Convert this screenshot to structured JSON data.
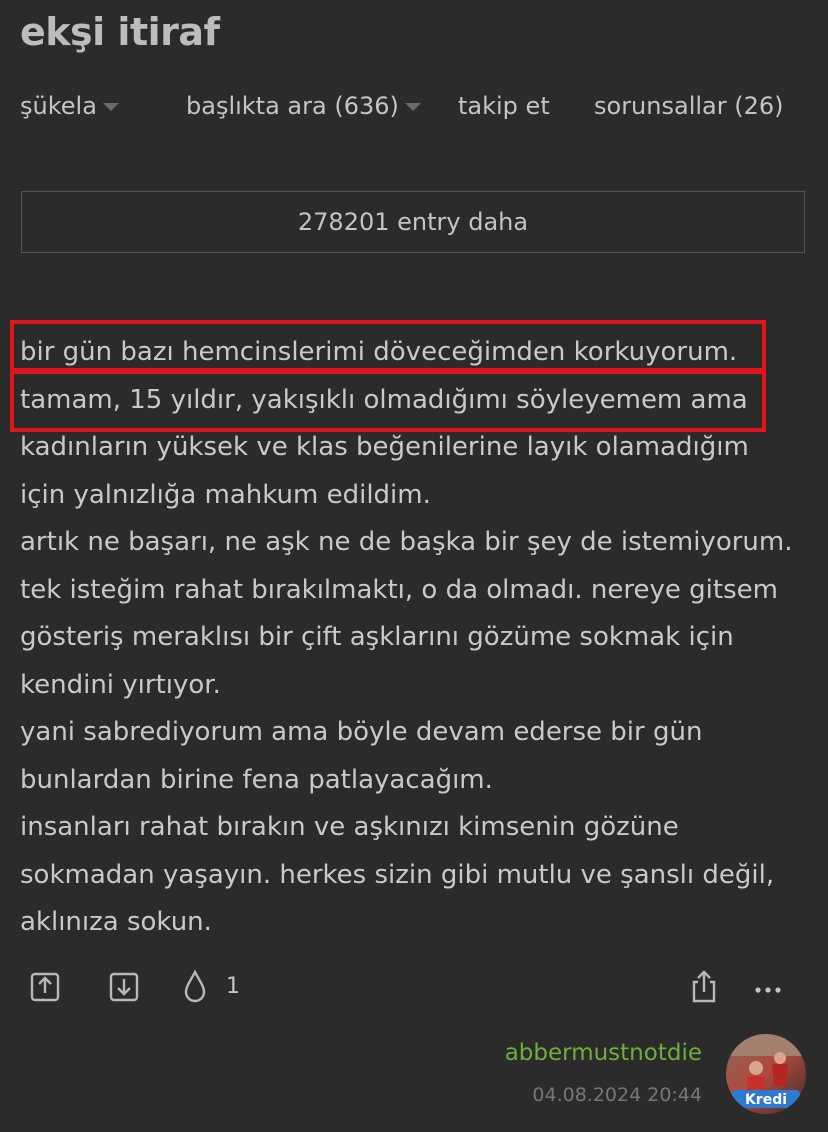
{
  "page": {
    "title": "ekşi itiraf"
  },
  "nav": {
    "items": [
      {
        "label": "şükela"
      },
      {
        "label": "başlıkta ara (636)"
      },
      {
        "label": "takip et"
      },
      {
        "label": "sorunsallar (26)"
      }
    ]
  },
  "more_entries": {
    "label": "278201 entry daha"
  },
  "entry": {
    "lines": [
      "bir gün bazı hemcinslerimi döveceğimden korkuyorum.",
      "tamam, 15 yıldır, yakışıklı olmadığımı söyleyemem ama",
      "kadınların yüksek ve klas beğenilerine layık olamadığım",
      "için yalnızlığa mahkum edildim.",
      "artık ne başarı, ne aşk ne de başka bir şey de istemiyorum.",
      "tek isteğim rahat bırakılmaktı, o da olmadı. nereye gitsem",
      "gösteriş meraklısı bir çift aşklarını gözüme sokmak için",
      "kendini yırtıyor.",
      "yani sabrediyorum ama böyle devam ederse bir gün",
      "bunlardan birine fena patlayacağım.",
      "insanları rahat bırakın ve aşkınızı kimsenin gözüne",
      "sokmadan yaşayın. herkes sizin gibi mutlu ve şanslı değil,",
      "aklınıza sokun."
    ],
    "favorite_count": "1",
    "author": "abbermustnotdie",
    "date": "04.08.2024 20:44",
    "avatar_text": "Kredi"
  },
  "icons": {
    "upvote": "upvote-icon",
    "downvote": "downvote-icon",
    "favorite": "drop-icon",
    "share": "share-icon",
    "more": "more-dots-icon",
    "nav_caret": "chevron-down-icon"
  },
  "colors": {
    "background": "#2b2b2b",
    "text": "#c9c9c9",
    "author": "#6fae3b",
    "date": "#777777",
    "highlight": "#e0141b",
    "border": "#555555"
  }
}
